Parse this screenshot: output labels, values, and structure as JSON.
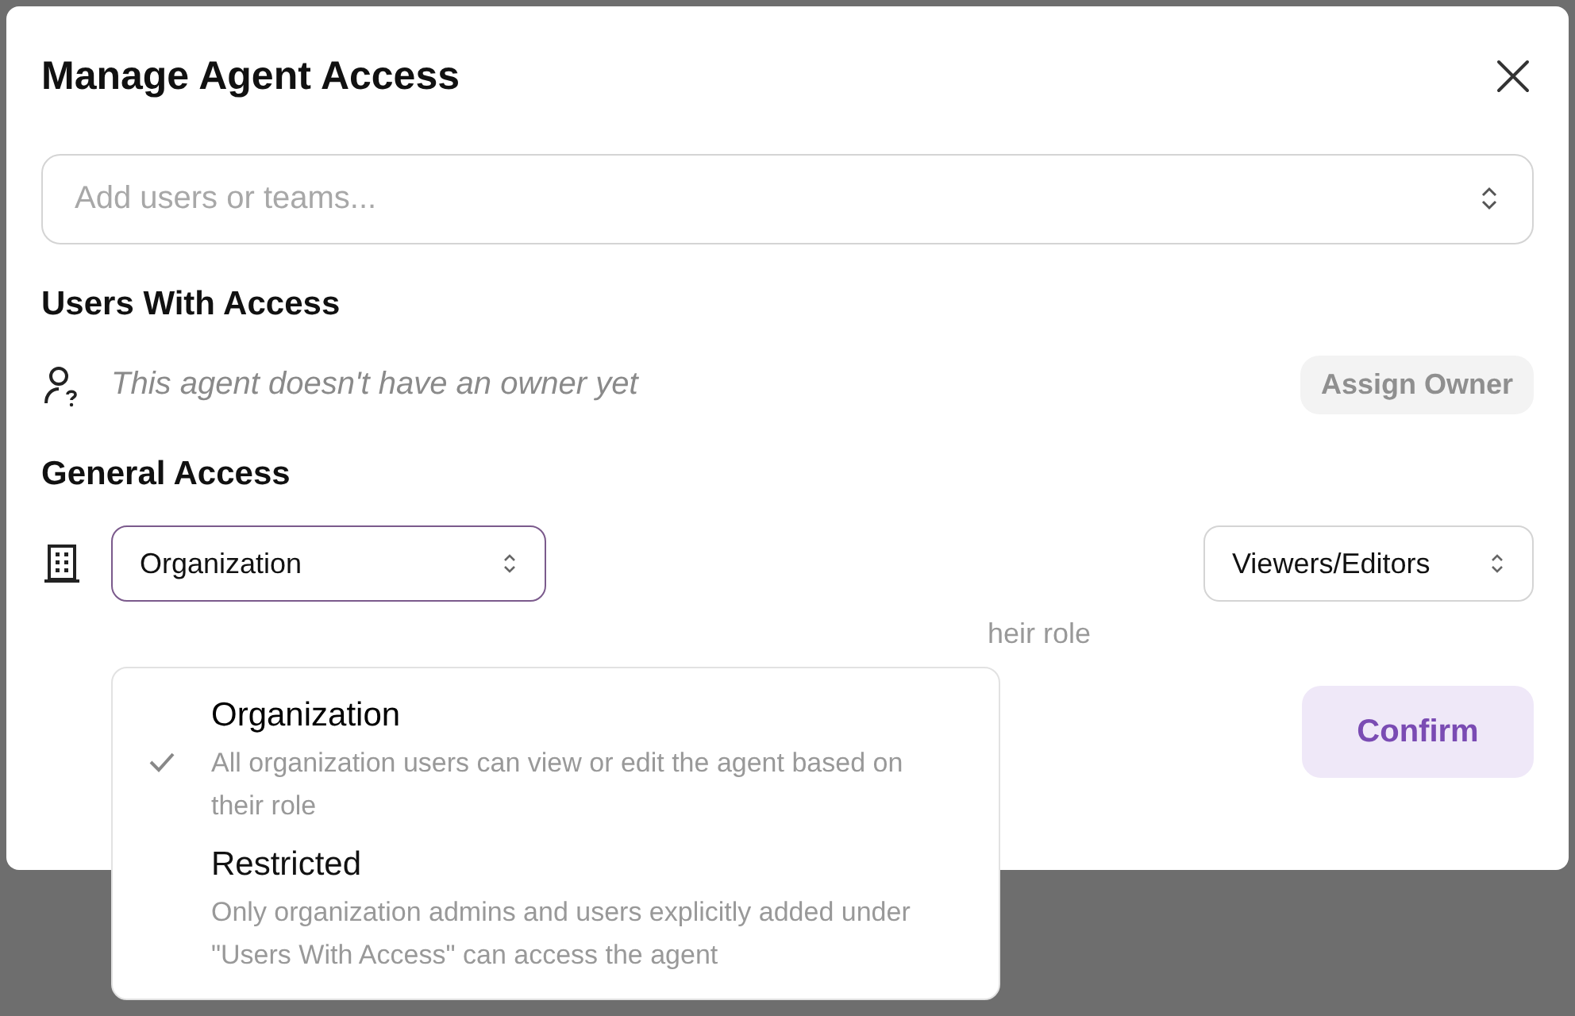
{
  "dialog": {
    "title": "Manage Agent Access"
  },
  "search": {
    "placeholder": "Add users or teams..."
  },
  "users_section": {
    "heading": "Users With Access",
    "empty_text": "This agent doesn't have an owner yet",
    "assign_button": {
      "label": "Assign Owner",
      "disabled": true
    }
  },
  "general_section": {
    "heading": "General Access",
    "access_select": {
      "value": "Organization",
      "expanded": true
    },
    "role_select": {
      "value": "Viewers/Editors"
    },
    "description": "heir role"
  },
  "menu": {
    "options": [
      {
        "label": "Organization",
        "description": "All organization users can view or edit the agent based on their role",
        "selected": true
      },
      {
        "label": "Restricted",
        "description": "Only organization admins and users explicitly added under \"Users With Access\" can access the agent",
        "selected": false
      }
    ]
  },
  "confirm_button": {
    "label": "Confirm"
  }
}
